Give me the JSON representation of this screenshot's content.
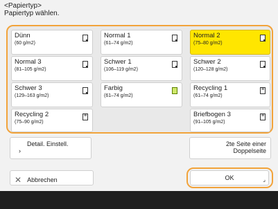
{
  "header": {
    "title": "<Papiertyp>",
    "subtitle": "Papiertyp wählen."
  },
  "paper_types": [
    {
      "name": "Dünn",
      "range": "(60 g/m2)",
      "icon": "corner-paper-icon",
      "selected": false
    },
    {
      "name": "Normal 1",
      "range": "(61–74 g/m2)",
      "icon": "corner-paper-icon",
      "selected": false
    },
    {
      "name": "Normal 2",
      "range": "(75–80 g/m2)",
      "icon": "corner-paper-icon",
      "selected": true
    },
    {
      "name": "Normal 3",
      "range": "(81–105 g/m2)",
      "icon": "corner-paper-icon",
      "selected": false
    },
    {
      "name": "Schwer 1",
      "range": "(106–119 g/m2)",
      "icon": "corner-paper-icon",
      "selected": false
    },
    {
      "name": "Schwer 2",
      "range": "(120–128 g/m2)",
      "icon": "corner-paper-icon",
      "selected": false
    },
    {
      "name": "Schwer 3",
      "range": "(129–163 g/m2)",
      "icon": "corner-paper-icon",
      "selected": false
    },
    {
      "name": "Farbig",
      "range": "(61–74 g/m2)",
      "icon": "colored-paper-icon",
      "selected": false
    },
    {
      "name": "Recycling 1",
      "range": "(61–74 g/m2)",
      "icon": "recycled-paper-icon",
      "selected": false
    },
    {
      "name": "Recycling 2",
      "range": "(75–90 g/m2)",
      "icon": "recycled-paper-icon",
      "selected": false
    },
    {
      "name": "Briefbogen 3",
      "range": "(91–105 g/m2)",
      "icon": "letterhead-paper-icon",
      "selected": false
    }
  ],
  "buttons": {
    "detail": "Detail. Einstell.",
    "double_side": "2te Seite einer Doppelseite",
    "cancel": "Abbrechen",
    "ok": "OK"
  },
  "colors": {
    "selected": "#ffe600",
    "focus_frame": "#f2a33a"
  }
}
